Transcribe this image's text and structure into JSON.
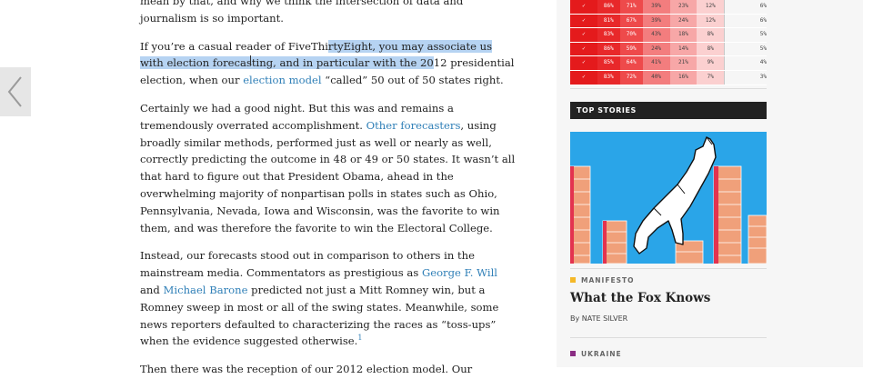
{
  "article": {
    "p0_text": "mean by that, and why we think the intersection of data and journalism is so important.",
    "p1": {
      "before": "If you’re a casual reader of FiveThi",
      "selected": "rtyEight, you may associate us with election forecasting, and in particular with the 20",
      "after_a": "12 presidential election, when our ",
      "link": "election model",
      "after_b": " “called” 50 out of 50 states right."
    },
    "p2": {
      "a": "Certainly we had a good night. But this was and remains a tremendously overrated accomplishment. ",
      "link": "Other forecasters",
      "b": ", using broadly similar methods, performed just as well or nearly as well, correctly predicting the outcome in 48 or 49 or 50 states. It wasn’t all that hard to figure out that President Obama, ahead in the overwhelming majority of nonpartisan polls in states such as Ohio, Pennsylvania, Nevada, Iowa and Wisconsin, was the favorite to win them, and was therefore the favorite to win the Electoral College."
    },
    "p3": {
      "a": "Instead, our forecasts stood out in comparison to others in the mainstream media. Commentators as prestigious as ",
      "link1": "George F. Will",
      "b": " and ",
      "link2": "Michael Barone",
      "c": " predicted not just a Mitt Romney win, but a Romney sweep in most or all of the swing states. Meanwhile, some news reporters defaulted to characterizing the races as “toss-ups” when the evidence suggested otherwise.",
      "footnote": "1"
    },
    "p4_text": "Then there was the reception of our 2012 election model. Our"
  },
  "sidebar": {
    "table_rows": [
      [
        "✓",
        "86%",
        "71%",
        "39%",
        "23%",
        "12%",
        "6%"
      ],
      [
        "✓",
        "81%",
        "67%",
        "39%",
        "24%",
        "12%",
        "6%"
      ],
      [
        "✓",
        "83%",
        "70%",
        "43%",
        "18%",
        "8%",
        "5%"
      ],
      [
        "✓",
        "86%",
        "59%",
        "24%",
        "14%",
        "8%",
        "5%"
      ],
      [
        "✓",
        "85%",
        "64%",
        "41%",
        "21%",
        "9%",
        "4%"
      ],
      [
        "✓",
        "83%",
        "72%",
        "40%",
        "16%",
        "7%",
        "3%"
      ]
    ],
    "top_stories_label": "TOP STORIES",
    "story1": {
      "category": "MANIFESTO",
      "category_color": "#f5b828",
      "title": "What the Fox Knows",
      "byline": "By NATE SILVER"
    },
    "story2": {
      "category": "UKRAINE",
      "category_color": "#8a2d83"
    }
  },
  "colors": {
    "link": "#2f7fb7",
    "selection": "#b6d3f2",
    "image_sky": "#2aa5e8",
    "brick": "#f0a07a"
  },
  "icons": {
    "nav_prev": "chevron-left-icon",
    "fox": "fox-illustration"
  }
}
